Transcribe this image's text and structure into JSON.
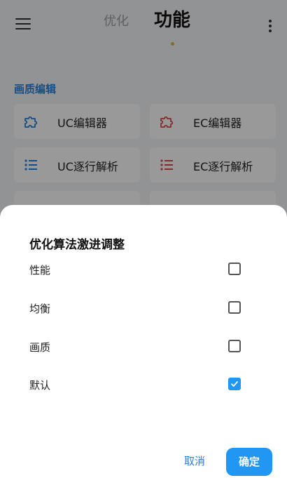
{
  "header": {
    "tab_optimize": "优化",
    "tab_function": "功能"
  },
  "section": {
    "title": "画质编辑"
  },
  "cards": [
    {
      "label": "UC编辑器",
      "icon": "puzzle-icon",
      "color": "#2a7fd8"
    },
    {
      "label": "EC编辑器",
      "icon": "puzzle-icon",
      "color": "#d94b4b"
    },
    {
      "label": "UC逐行解析",
      "icon": "list-icon",
      "color": "#2a7fd8"
    },
    {
      "label": "EC逐行解析",
      "icon": "list-icon",
      "color": "#d94b4b"
    }
  ],
  "dialog": {
    "title": "优化算法激进调整",
    "options": [
      {
        "label": "性能",
        "checked": false
      },
      {
        "label": "均衡",
        "checked": false
      },
      {
        "label": "画质",
        "checked": false
      },
      {
        "label": "默认",
        "checked": true
      }
    ],
    "cancel_label": "取消",
    "confirm_label": "确定"
  },
  "colors": {
    "accent": "#2196f3",
    "section_title": "#2a7fd8",
    "ec_icon": "#d94b4b"
  }
}
